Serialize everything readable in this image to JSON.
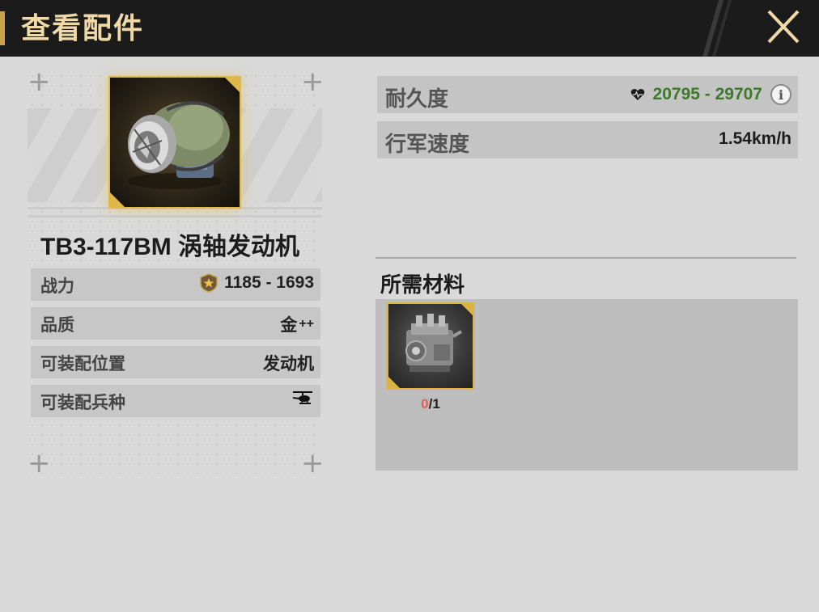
{
  "header": {
    "title": "查看配件",
    "close_icon": "close-icon",
    "accent_color": "#c7a24a"
  },
  "item": {
    "name": "TB3-117BM 涡轴发动机",
    "icon": "turboshaft-engine-image",
    "rarity_color": "#e0b84a"
  },
  "stats": [
    {
      "label": "战力",
      "value": "1185 - 1693",
      "icon": "power-badge-icon"
    },
    {
      "label": "品质",
      "value": "金",
      "suffix": "++"
    },
    {
      "label": "可装配位置",
      "value": "发动机"
    },
    {
      "label": "可装配兵种",
      "icon": "helicopter-icon"
    }
  ],
  "attributes": [
    {
      "label": "耐久度",
      "value": "20795 - 29707",
      "icon": "heart-icon",
      "value_color": "#3d7a2a",
      "info_icon": "info-icon",
      "info_glyph": "i"
    },
    {
      "label": "行军速度",
      "value": "1.54km/h"
    }
  ],
  "materials": {
    "title": "所需材料",
    "items": [
      {
        "icon": "engine-block-image",
        "have": "0",
        "sep_need": "/1"
      }
    ]
  }
}
